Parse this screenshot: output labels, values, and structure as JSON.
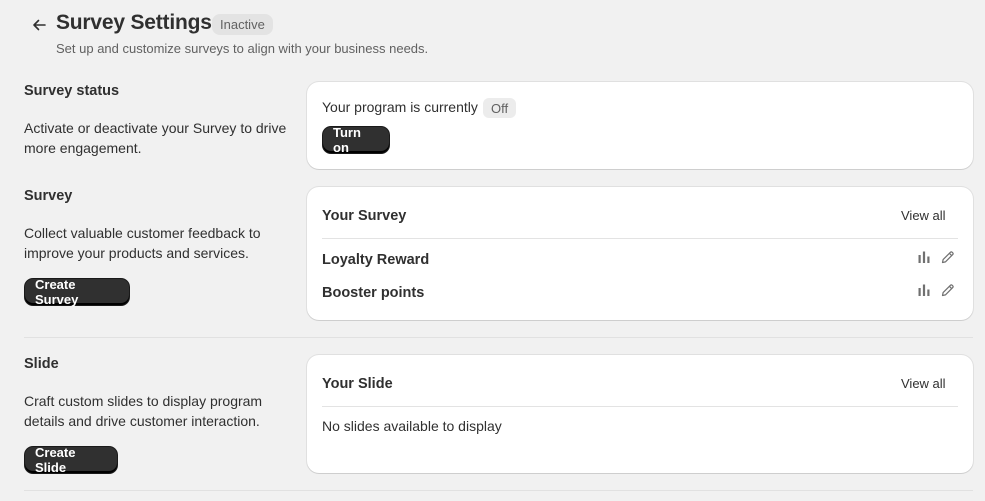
{
  "header": {
    "title": "Survey Settings",
    "status": "Inactive",
    "subtitle": "Set up and customize surveys to align with your business needs."
  },
  "sections": {
    "status": {
      "title": "Survey status",
      "description": "Activate or deactivate your Survey to drive more engagement.",
      "card": {
        "program_text": "Your program is currently",
        "state_badge": "Off",
        "button_label": "Turn on"
      }
    },
    "survey": {
      "title": "Survey",
      "description": "Collect valuable customer feedback to improve your products and services.",
      "button_label": "Create Survey",
      "card": {
        "heading": "Your Survey",
        "view_all": "View all",
        "items": [
          {
            "label": "Loyalty Reward"
          },
          {
            "label": "Booster points"
          }
        ]
      }
    },
    "slide": {
      "title": "Slide",
      "description": "Craft custom slides to display program details and drive customer interaction.",
      "button_label": "Create Slide",
      "card": {
        "heading": "Your Slide",
        "view_all": "View all",
        "empty_text": "No slides available to display"
      }
    }
  },
  "icons": {
    "back": "arrow-left-icon",
    "analytics": "bar-chart-icon",
    "edit": "pencil-icon"
  },
  "colors": {
    "background": "#f1f1f1",
    "card": "#ffffff",
    "primary_button": "#303030",
    "badge": "#e3e3e3"
  }
}
